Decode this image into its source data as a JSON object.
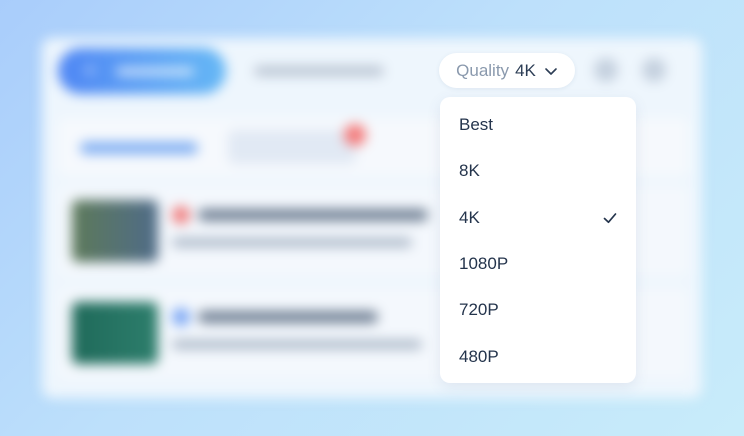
{
  "quality": {
    "label": "Quality",
    "selected": "4K"
  },
  "dropdown": {
    "options": [
      "Best",
      "8K",
      "4K",
      "1080P",
      "720P",
      "480P"
    ],
    "selected_index": 2
  },
  "colors": {
    "accent": "#4f86f4",
    "text_primary": "#24344c",
    "text_muted": "#8a99ad",
    "badge": "#f47a7a"
  }
}
